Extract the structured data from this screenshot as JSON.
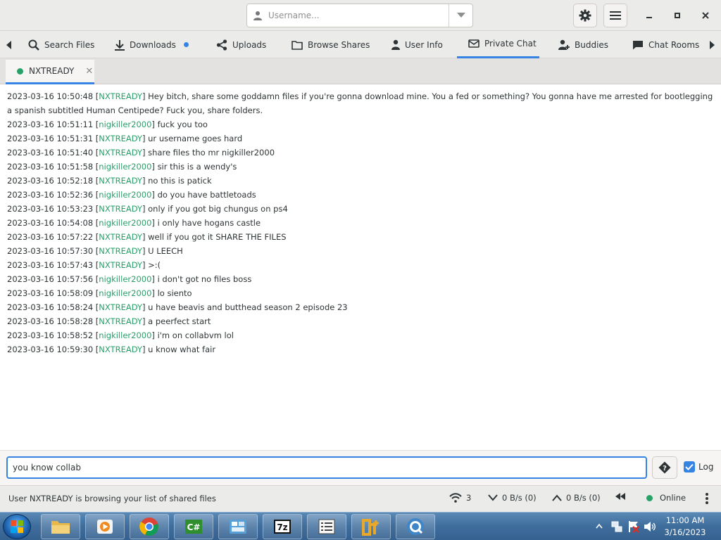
{
  "header": {
    "username_placeholder": "Username...",
    "username_value": ""
  },
  "tabs": [
    {
      "label": "Search Files",
      "icon": "search-icon"
    },
    {
      "label": "Downloads",
      "icon": "download-icon"
    },
    {
      "label": "Uploads",
      "icon": "share-icon"
    },
    {
      "label": "Browse Shares",
      "icon": "folder-icon"
    },
    {
      "label": "User Info",
      "icon": "person-icon"
    },
    {
      "label": "Private Chat",
      "icon": "mail-icon",
      "active": true
    },
    {
      "label": "Buddies",
      "icon": "add-person-icon"
    },
    {
      "label": "Chat Rooms",
      "icon": "chat-bubble-icon"
    }
  ],
  "chat_tab": {
    "name": "NXTREADY",
    "status_color": "#26a269"
  },
  "messages": [
    {
      "time": "2023-03-16 10:50:48",
      "nick": "NXTREADY",
      "text": "Hey bitch, share some goddamn files if you're gonna download mine. You a fed or something? You gonna have me arrested for bootlegging a spanish subtitled Human Centipede? Fuck you, share folders."
    },
    {
      "time": "2023-03-16 10:51:11",
      "nick": "nigkiller2000",
      "text": "fuck you too"
    },
    {
      "time": "2023-03-16 10:51:31",
      "nick": "NXTREADY",
      "text": "ur username goes hard"
    },
    {
      "time": "2023-03-16 10:51:40",
      "nick": "NXTREADY",
      "text": "share files tho mr nigkiller2000"
    },
    {
      "time": "2023-03-16 10:51:58",
      "nick": "nigkiller2000",
      "text": "sir this is a wendy's"
    },
    {
      "time": "2023-03-16 10:52:18",
      "nick": "NXTREADY",
      "text": "no this is patick"
    },
    {
      "time": "2023-03-16 10:52:36",
      "nick": "nigkiller2000",
      "text": "do you have battletoads"
    },
    {
      "time": "2023-03-16 10:53:23",
      "nick": "NXTREADY",
      "text": "only if you got big chungus on ps4"
    },
    {
      "time": "2023-03-16 10:54:08",
      "nick": "nigkiller2000",
      "text": "i only have hogans castle"
    },
    {
      "time": "2023-03-16 10:57:22",
      "nick": "NXTREADY",
      "text": "well if you got it SHARE THE FILES"
    },
    {
      "time": "2023-03-16 10:57:30",
      "nick": "NXTREADY",
      "text": "U LEECH"
    },
    {
      "time": "2023-03-16 10:57:43",
      "nick": "NXTREADY",
      "text": ">:("
    },
    {
      "time": "2023-03-16 10:57:56",
      "nick": "nigkiller2000",
      "text": "i don't got no files boss"
    },
    {
      "time": "2023-03-16 10:58:09",
      "nick": "nigkiller2000",
      "text": "lo siento"
    },
    {
      "time": "2023-03-16 10:58:24",
      "nick": "NXTREADY",
      "text": "u have beavis and butthead season 2 episode 23"
    },
    {
      "time": "2023-03-16 10:58:28",
      "nick": "NXTREADY",
      "text": "a peerfect start"
    },
    {
      "time": "2023-03-16 10:58:52",
      "nick": "nigkiller2000",
      "text": "i'm on collabvm lol"
    },
    {
      "time": "2023-03-16 10:59:30",
      "nick": "NXTREADY",
      "text": "u know what fair"
    }
  ],
  "input": {
    "value": "you know collab",
    "log_label": "Log",
    "log_checked": true
  },
  "statusbar": {
    "message": "User NXTREADY is browsing your list of shared files",
    "connections": "3",
    "download_speed": "0 B/s (0)",
    "upload_speed": "0 B/s (0)",
    "status": "Online",
    "status_color": "#26a269"
  },
  "taskbar": {
    "time": "11:00 AM",
    "date": "3/16/2023",
    "apps": [
      "explorer-icon",
      "media-player-icon",
      "chrome-icon",
      "csharp-icon",
      "control-panel-icon",
      "7zip-icon",
      "list-icon",
      "notepad-plus-icon",
      "quicktime-icon"
    ]
  },
  "colors": {
    "accent": "#3584e4",
    "nick": "#26a269"
  }
}
